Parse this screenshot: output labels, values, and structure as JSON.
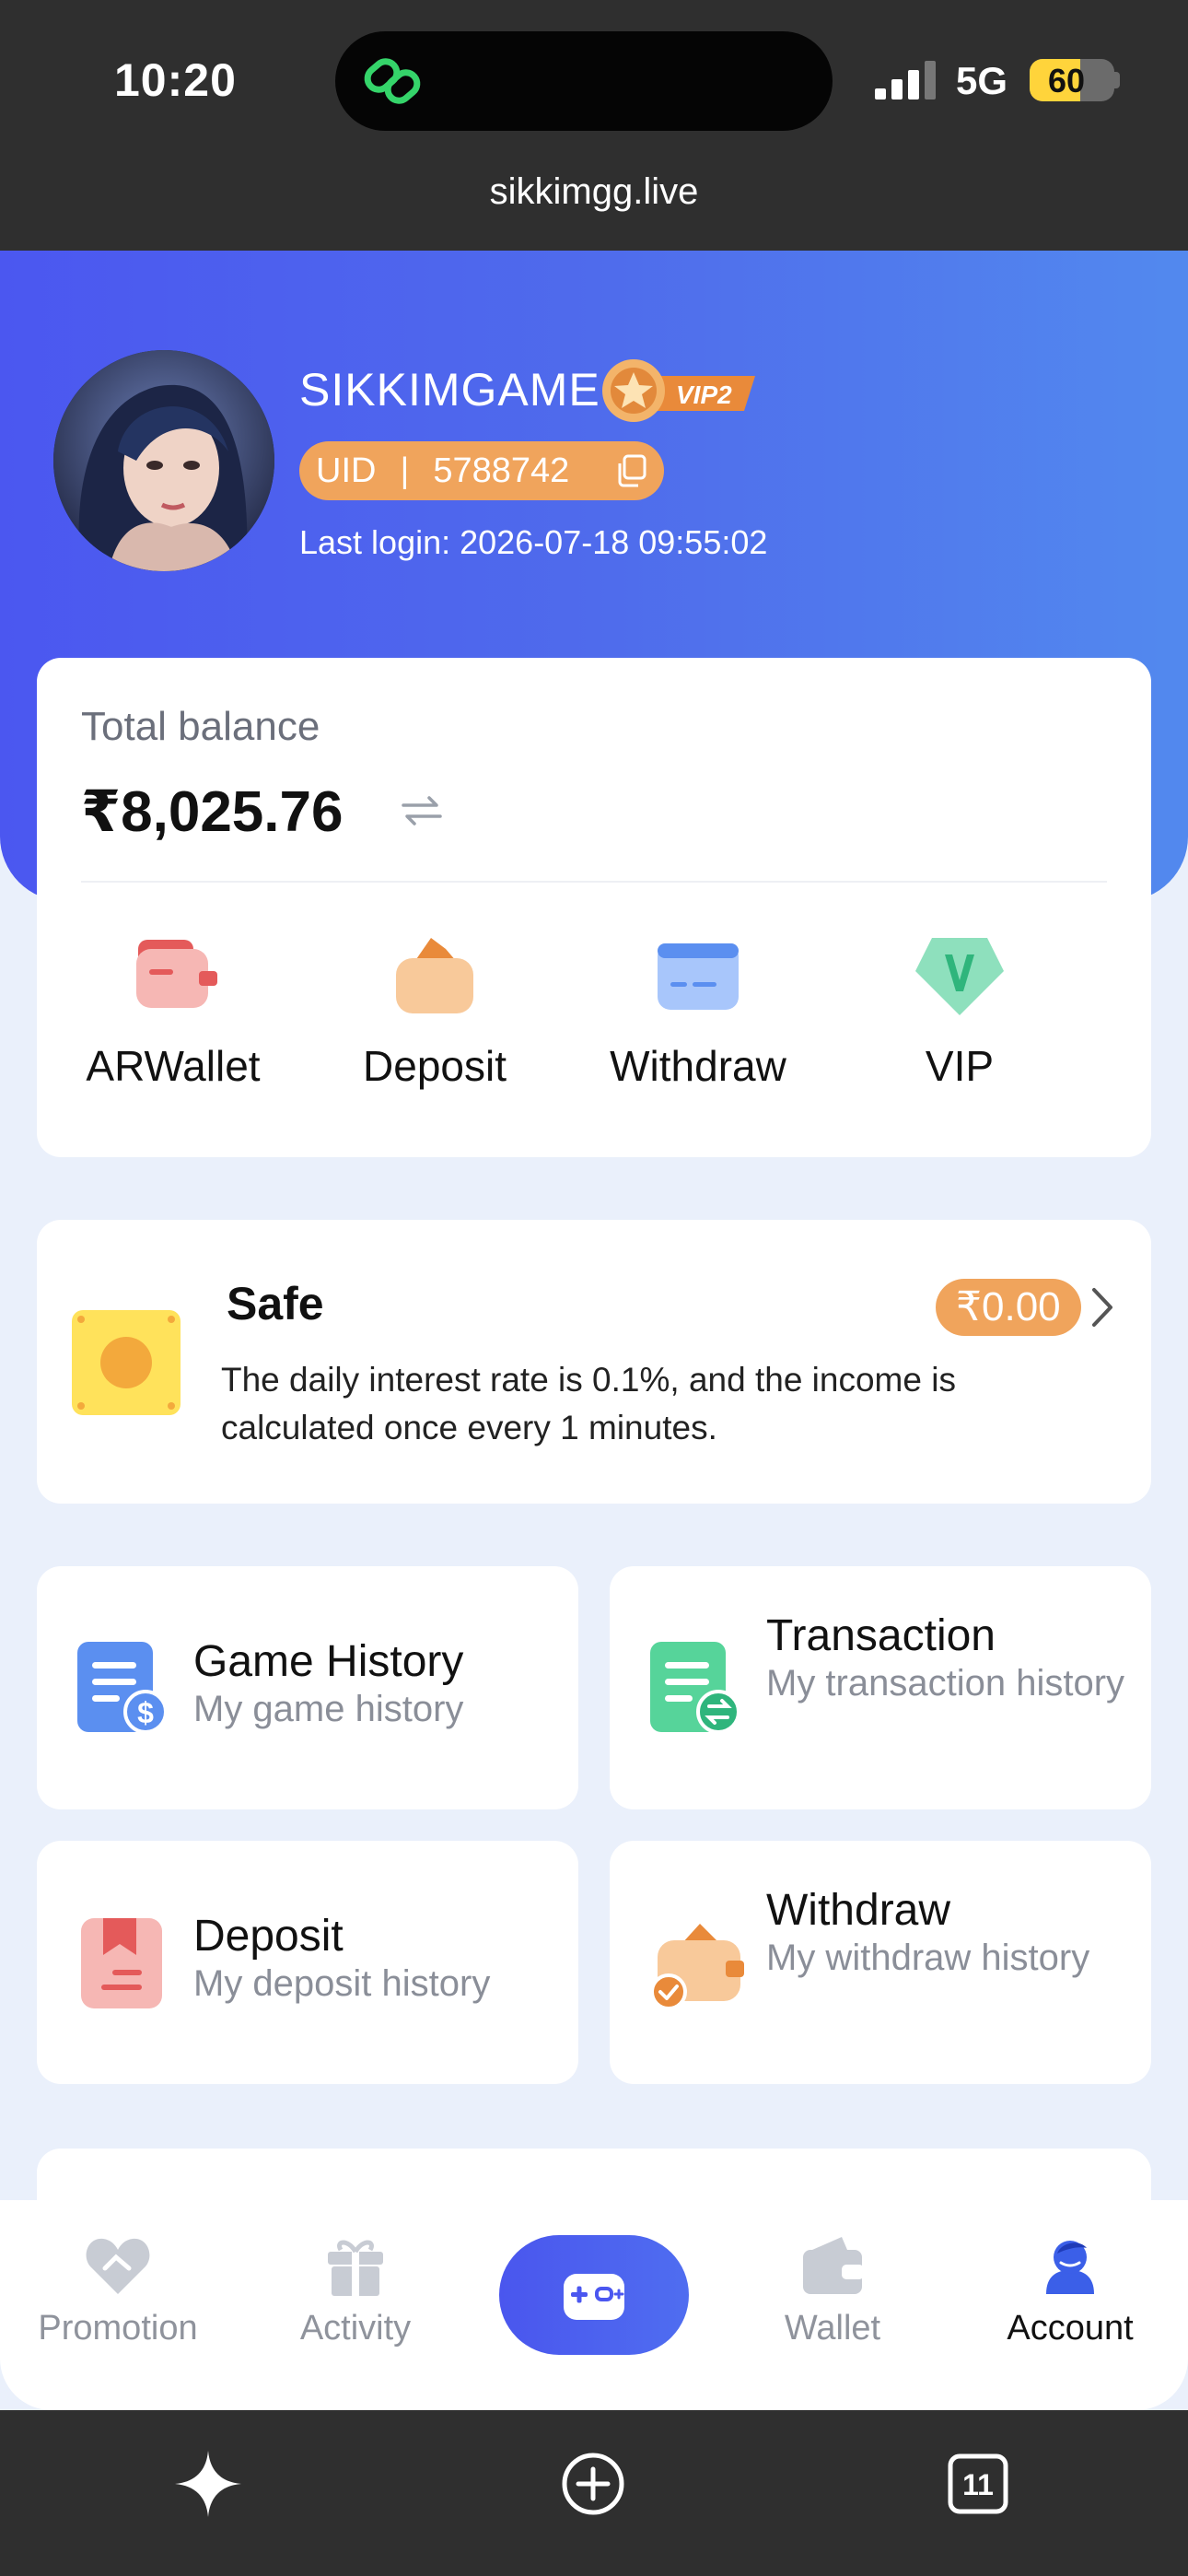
{
  "status_bar": {
    "time": "10:20",
    "network": "5G",
    "battery_level": "60",
    "battery_fraction": 0.6
  },
  "browser": {
    "url": "sikkimgg.live",
    "tabs_count": "11"
  },
  "profile": {
    "username": "SIKKIMGAME",
    "vip_badge": "VIP2",
    "uid_label": "UID",
    "uid_sep": "|",
    "uid_value": "5788742",
    "last_login": "Last login: 2026-07-18 09:55:02"
  },
  "balance": {
    "label": "Total balance",
    "value": "₹8,025.76"
  },
  "quick_actions": [
    {
      "label": "ARWallet",
      "icon": "arwallet-icon"
    },
    {
      "label": "Deposit",
      "icon": "deposit-icon"
    },
    {
      "label": "Withdraw",
      "icon": "withdraw-icon"
    },
    {
      "label": "VIP",
      "icon": "vip-icon"
    }
  ],
  "safe": {
    "title": "Safe",
    "amount": "₹0.00",
    "description": "The daily interest rate is 0.1%, and the income is calculated once every 1 minutes."
  },
  "history": {
    "game": {
      "title": "Game History",
      "subtitle": "My game history"
    },
    "transaction": {
      "title": "Transaction",
      "subtitle": "My transaction history"
    },
    "deposit": {
      "title": "Deposit",
      "subtitle": "My deposit history"
    },
    "withdraw": {
      "title": "Withdraw",
      "subtitle": "My withdraw history"
    }
  },
  "bottom_nav": {
    "promotion": "Promotion",
    "activity": "Activity",
    "wallet": "Wallet",
    "account": "Account",
    "active": "account"
  },
  "colors": {
    "brand_blue": "#4b57f0",
    "accent_orange": "#f0a45c",
    "background": "#eaf0fb"
  }
}
